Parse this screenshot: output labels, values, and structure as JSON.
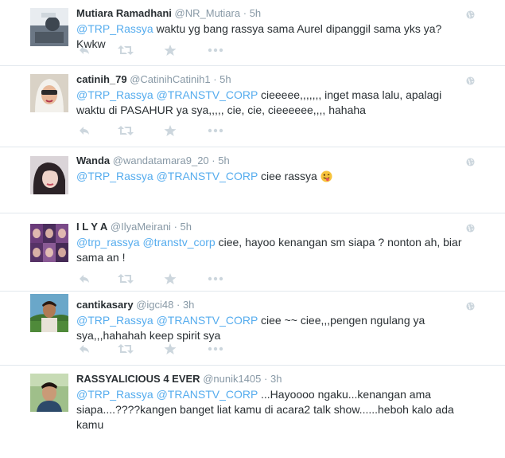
{
  "tweets": [
    {
      "name": "Mutiara Ramadhani",
      "handle": "@NR_Mutiara",
      "separator": "·",
      "time": "5h",
      "mentions": [
        "@TRP_Rassya"
      ],
      "text": "waktu yg bang rassya sama Aurel dipanggil sama yks ya? Kwkw"
    },
    {
      "name": "catinih_79",
      "handle": "@CatinihCatinih1",
      "separator": "·",
      "time": "5h",
      "mentions": [
        "@TRP_Rassya",
        "@TRANSTV_CORP"
      ],
      "text": "cieeeee,,,,,,, inget masa lalu, apalagi waktu di PASAHUR ya sya,,,,, cie, cie, cieeeeee,,,, hahaha"
    },
    {
      "name": "Wanda",
      "handle": "@wandatamara9_20",
      "separator": "·",
      "time": "5h",
      "mentions": [
        "@TRP_Rassya",
        "@TRANSTV_CORP"
      ],
      "text": "ciee rassya",
      "emoji": "winking-face-tongue"
    },
    {
      "name": "I L Y A",
      "handle": "@IlyaMeirani",
      "separator": "·",
      "time": "5h",
      "mentions": [
        "@trp_rassya",
        "@transtv_corp"
      ],
      "text": "ciee, hayoo kenangan sm siapa ? nonton ah, biar sama an !"
    },
    {
      "name": "cantikasary",
      "handle": "@igci48",
      "separator": "·",
      "time": "3h",
      "mentions": [
        "@TRP_Rassya",
        "@TRANSTV_CORP"
      ],
      "text": "ciee ~~ ciee,,,pengen ngulang ya sya,,,hahahah keep spirit sya"
    },
    {
      "name": "RASSYALICIOUS 4 EVER",
      "handle": "@nunik1405",
      "separator": "·",
      "time": "3h",
      "mentions": [
        "@TRP_Rassya",
        "@TRANSTV_CORP"
      ],
      "text": "...Hayoooo ngaku...kenangan ama siapa....????kangen banget liat kamu di acara2 talk show......heboh kalo ada kamu"
    }
  ],
  "colors": {
    "link": "#55acee",
    "muted": "#8899a6",
    "icon": "#ccd6dd",
    "border": "#e1e8ed"
  },
  "icons": [
    "reply-icon",
    "retweet-icon",
    "favorite-icon",
    "more-icon",
    "globe-icon"
  ]
}
